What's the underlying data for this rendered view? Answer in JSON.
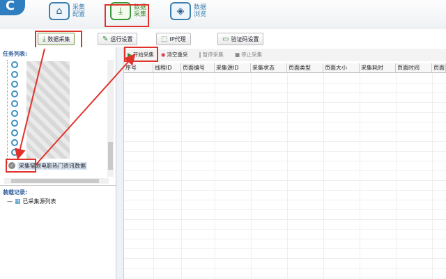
{
  "nav": {
    "items": [
      {
        "l1": "采集",
        "l2": "配置"
      },
      {
        "l1": "数据",
        "l2": "采集"
      },
      {
        "l1": "数据",
        "l2": "浏览"
      }
    ]
  },
  "subtabs": [
    "数据采集",
    "运行设置",
    "IP代理",
    "验证码设置"
  ],
  "task_list_title": "任务列表:",
  "selected_task": "采集猫眼电影热门资讯数据",
  "log_title": "装载记录:",
  "log_item": "已采集源列表",
  "controls": [
    "开始采集",
    "清空重采",
    "暂停采集",
    "停止采集"
  ],
  "columns": [
    "序号",
    "线程ID",
    "页面编号",
    "采集源ID",
    "采集状态",
    "页面类型",
    "页面大小",
    "采集耗时",
    "页面时间",
    "页面"
  ]
}
